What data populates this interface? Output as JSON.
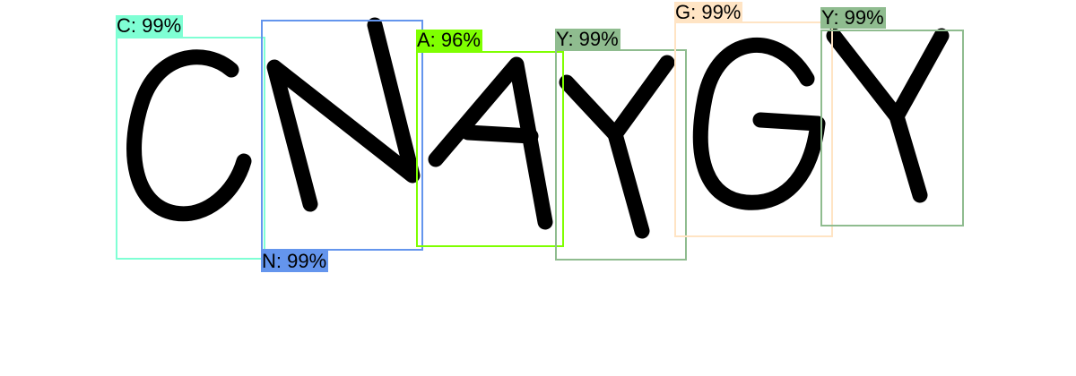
{
  "image": {
    "captcha_text": "CNAYGY",
    "glyph_color": "#000000",
    "background_color": "#ffffff"
  },
  "detections": [
    {
      "letter": "C",
      "label": "C: 99%",
      "color": "#7fffd4",
      "label_color": "#7fffd4"
    },
    {
      "letter": "N",
      "label": "N: 99%",
      "color": "#6495ed",
      "label_color": "#6495ed"
    },
    {
      "letter": "A",
      "label": "A: 96%",
      "color": "#7fff00",
      "label_color": "#7fff00"
    },
    {
      "letter": "Y",
      "label": "Y: 99%",
      "color": "#8fbc8f",
      "label_color": "#8fbc8f"
    },
    {
      "letter": "G",
      "label": "G: 99%",
      "color": "#ffe4c4",
      "label_color": "#ffe4c4"
    },
    {
      "letter": "Y",
      "label": "Y: 99%",
      "color": "#8fbc8f",
      "label_color": "#8fbc8f"
    }
  ]
}
